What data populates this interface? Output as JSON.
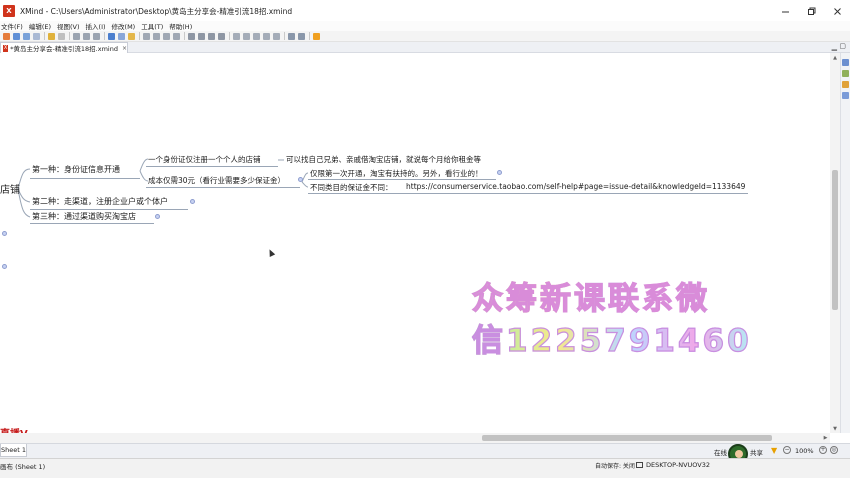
{
  "window": {
    "title": "XMind - C:\\Users\\Administrator\\Desktop\\黄岛主分享会-精准引流18招.xmind",
    "icon_label": "X"
  },
  "menu": [
    "文件(F)",
    "编辑(E)",
    "视图(V)",
    "插入(I)",
    "修改(M)",
    "工具(T)",
    "帮助(H)"
  ],
  "editor_tab": {
    "icon_label": "X",
    "label": "*黄岛主分享会-精准引流18招.xmind",
    "close": "×"
  },
  "mindmap": {
    "partial_left_topic": "店铺",
    "branches": [
      {
        "label": "第一种：身份证信息开通"
      },
      {
        "label": "第二种：走渠道，注册企业户或个体户"
      },
      {
        "label": "第三种：通过渠道购买淘宝店"
      }
    ],
    "sub_a": "一个身份证仅注册一个个人的店铺",
    "sub_a_child": "可以找自己兄弟、亲戚借淘宝店铺，就说每个月给你租金等",
    "sub_b": "成本仅需30元（看行业需要多少保证金）",
    "sub_b_child1": "仅限第一次开通，淘宝有扶持的。另外，看行业的！",
    "sub_b_child2": "不同类目的保证金不同：",
    "sub_b_child2_url": "https://consumerservice.taobao.com/self-help#page=issue-detail&knowledgeId=1133649",
    "partial_bottom_text": "直播V"
  },
  "watermark": {
    "line1": "众筹新课联系微",
    "line2": "信1225791460"
  },
  "sheet_tab": "Sheet 1",
  "share": {
    "left_text": "在线",
    "right_text": "共享"
  },
  "zoom": {
    "minus": "−",
    "value": "100%",
    "plus": "+",
    "fit": "◎"
  },
  "status": {
    "left": "画布 (Sheet 1)",
    "autosave": "自动保存: 关闭",
    "computer": "DESKTOP-NVUOV32"
  },
  "colors": {
    "accent": "#d0341c",
    "connector": "#9aa6b6",
    "watermark_stroke": "#d98cd9"
  }
}
